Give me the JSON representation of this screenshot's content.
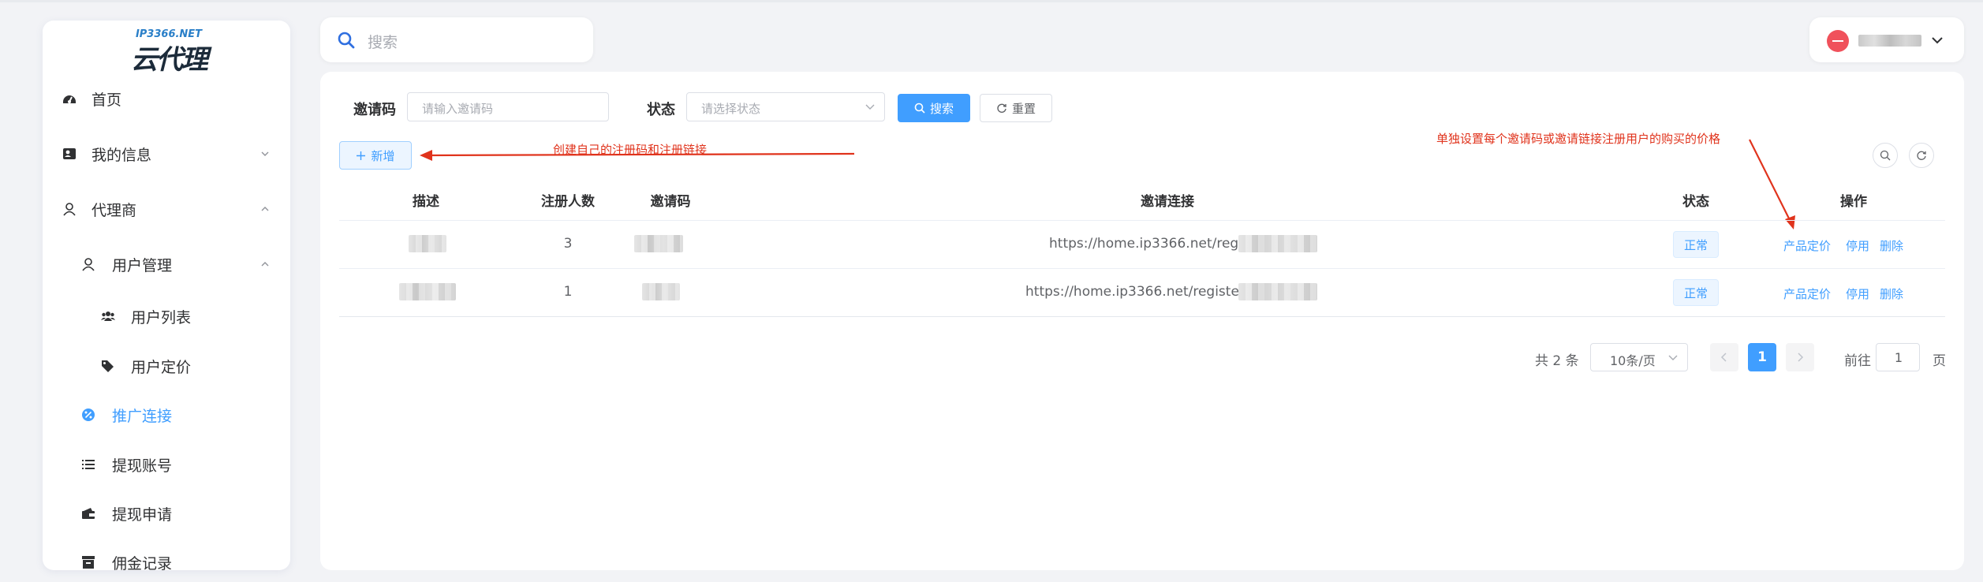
{
  "app": {
    "logo_domain": "IP3366.NET",
    "logo_name": "云代理"
  },
  "sidebar": {
    "items": [
      {
        "label": "首页",
        "icon": "dashboard-icon"
      },
      {
        "label": "我的信息",
        "icon": "id-card-icon",
        "expanded": false
      },
      {
        "label": "代理商",
        "icon": "agent-icon",
        "expanded": true
      },
      {
        "label": "用户管理",
        "icon": "user-icon",
        "expanded": true
      },
      {
        "label": "用户列表",
        "icon": "users-icon"
      },
      {
        "label": "用户定价",
        "icon": "tags-icon"
      },
      {
        "label": "推广连接",
        "icon": "percent-icon",
        "active": true
      },
      {
        "label": "提现账号",
        "icon": "list-icon"
      },
      {
        "label": "提现申请",
        "icon": "wallet-icon"
      },
      {
        "label": "佣金记录",
        "icon": "archive-icon"
      }
    ]
  },
  "search": {
    "placeholder": "搜索"
  },
  "filters": {
    "code_label": "邀请码",
    "code_placeholder": "请输入邀请码",
    "status_label": "状态",
    "status_placeholder": "请选择状态",
    "search_button": "搜索",
    "reset_button": "重置"
  },
  "toolbar": {
    "add_button": "新增"
  },
  "annotations": {
    "add_note": "创建自己的注册码和注册链接",
    "price_note": "单独设置每个邀请码或邀请链接注册用户的购买的价格"
  },
  "table": {
    "headers": [
      "描述",
      "注册人数",
      "邀请码",
      "邀请连接",
      "状态",
      "操作"
    ],
    "rows": [
      {
        "count": "3",
        "link": "https://home.ip3366.net/registe",
        "status": "正常"
      },
      {
        "count": "1",
        "link": "https://home.ip3366.net/register",
        "status": "正常"
      }
    ],
    "actions": {
      "price": "产品定价",
      "disable": "停用",
      "delete": "删除"
    }
  },
  "pagination": {
    "total": "共 2 条",
    "page_size": "10条/页",
    "current_page": "1",
    "goto_label": "前往",
    "goto_value": "1",
    "page_suffix": "页"
  },
  "colors": {
    "primary": "#409eff",
    "annotation": "#e0331c",
    "avatar": "#f0515b"
  }
}
